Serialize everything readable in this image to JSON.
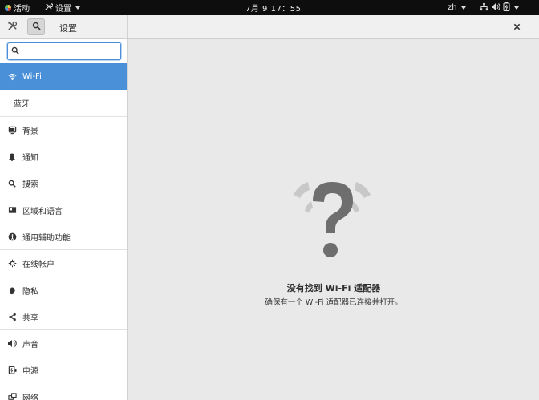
{
  "topbar": {
    "activities": "活动",
    "app_menu": "设置",
    "clock": "7月 9 17：55",
    "lang": "zh"
  },
  "header": {
    "title": "设置"
  },
  "search": {
    "placeholder": ""
  },
  "sidebar": {
    "items": [
      {
        "label": "Wi-Fi",
        "icon": "wifi-icon"
      },
      {
        "label": "蓝牙",
        "icon": ""
      },
      {
        "label": "背景",
        "icon": "background-icon"
      },
      {
        "label": "通知",
        "icon": "bell-icon"
      },
      {
        "label": "搜索",
        "icon": "search-icon"
      },
      {
        "label": "区域和语言",
        "icon": "flag-icon"
      },
      {
        "label": "通用辅助功能",
        "icon": "accessibility-icon"
      },
      {
        "label": "在线帐户",
        "icon": "online-accounts-icon"
      },
      {
        "label": "隐私",
        "icon": "hand-icon"
      },
      {
        "label": "共享",
        "icon": "share-icon"
      },
      {
        "label": "声音",
        "icon": "speaker-icon"
      },
      {
        "label": "电源",
        "icon": "power-icon"
      },
      {
        "label": "网络",
        "icon": "network-icon"
      }
    ]
  },
  "main": {
    "title": "没有找到 Wi-Fi 适配器",
    "subtitle": "确保有一个 Wi-Fi 适配器已连接并打开。"
  },
  "colors": {
    "accent": "#4a90d9",
    "topbar": "#0e0e0e"
  }
}
